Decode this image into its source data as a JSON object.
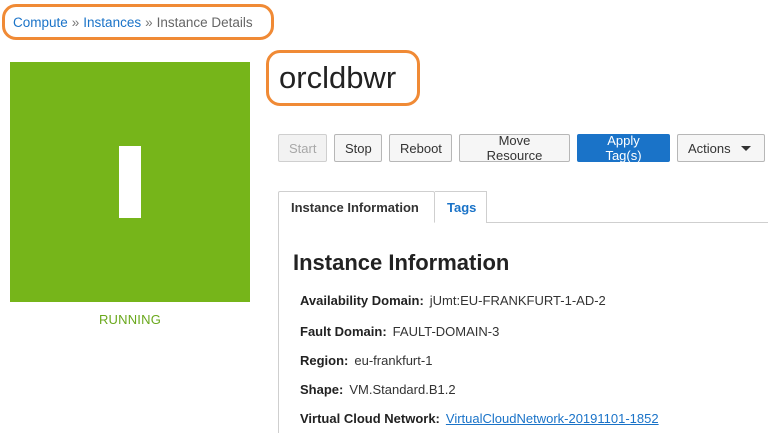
{
  "breadcrumb": {
    "items": [
      "Compute",
      "Instances"
    ],
    "separator": "»",
    "current": "Instance Details"
  },
  "instance": {
    "name": "orcldbwr",
    "status": "RUNNING",
    "status_color": "#76b51a",
    "tile_letter_icon": "instance-letter-icon"
  },
  "toolbar": {
    "start": "Start",
    "stop": "Stop",
    "reboot": "Reboot",
    "move": "Move Resource",
    "apply_tags": "Apply Tag(s)",
    "actions": "Actions"
  },
  "tabs": [
    "Instance Information",
    "Tags"
  ],
  "info": {
    "heading": "Instance Information",
    "availability_domain": {
      "label": "Availability Domain:",
      "value": "jUmt:EU-FRANKFURT-1-AD-2"
    },
    "fault_domain": {
      "label": "Fault Domain:",
      "value": "FAULT-DOMAIN-3"
    },
    "region": {
      "label": "Region:",
      "value": "eu-frankfurt-1"
    },
    "shape": {
      "label": "Shape:",
      "value": "VM.Standard.B1.2"
    },
    "vcn": {
      "label": "Virtual Cloud Network:",
      "value": "VirtualCloudNetwork-20191101-1852"
    }
  },
  "colors": {
    "accent": "#1a73c8",
    "highlight": "#f08a35"
  }
}
